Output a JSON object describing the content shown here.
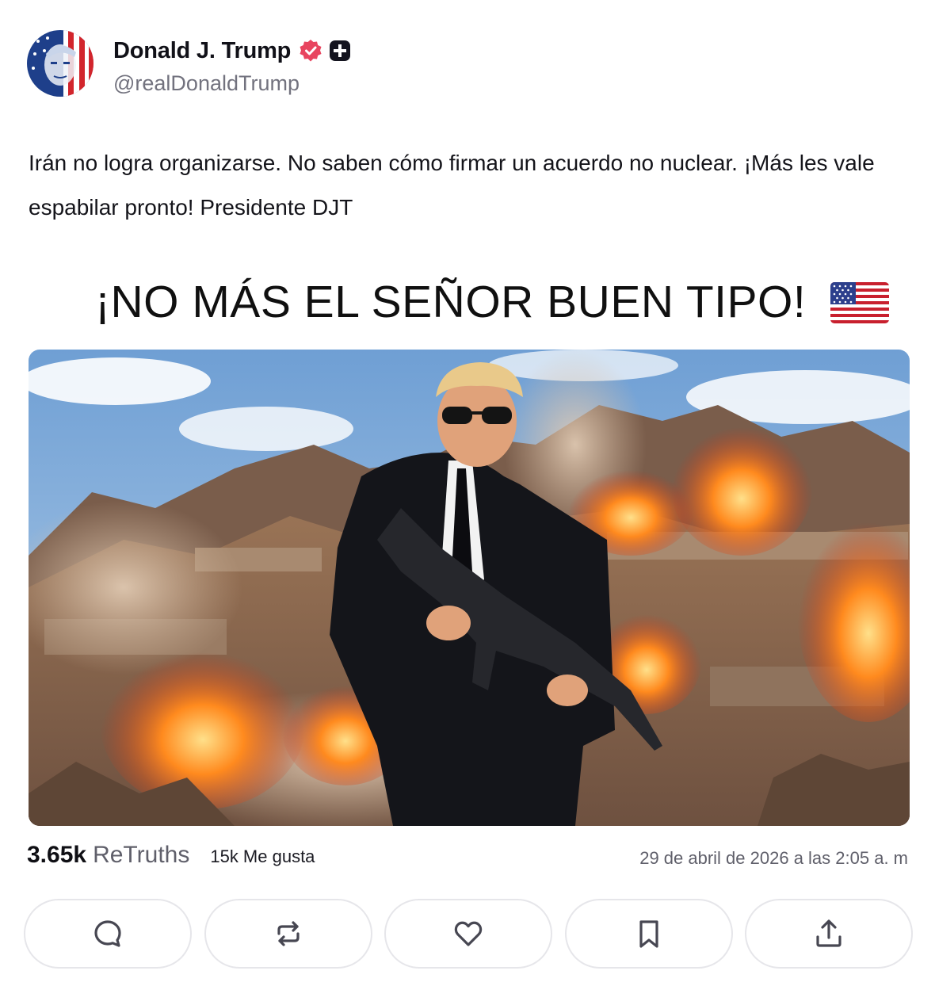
{
  "author": {
    "display_name": "Donald J. Trump",
    "handle": "@realDonaldTrump",
    "verified_icon": "verified-badge-icon",
    "plus_icon": "plus-badge-icon",
    "accent_color": "#e8455f"
  },
  "post": {
    "text": "Irán no logra organizarse. No saben cómo firmar un acuerdo no nuclear. ¡Más les vale espabilar pronto! Presidente DJT",
    "media": {
      "headline": "¡NO MÁS EL SEÑOR BUEN TIPO!",
      "flag_icon": "us-flag-icon"
    }
  },
  "stats": {
    "retruths_count": "3.65k",
    "retruths_label": "ReTruths",
    "likes": "15k Me gusta",
    "timestamp": "29 de abril de 2026 a las 2:05 a. m"
  },
  "actions": [
    {
      "icon": "reply-icon"
    },
    {
      "icon": "retruth-icon"
    },
    {
      "icon": "like-icon"
    },
    {
      "icon": "bookmark-icon"
    },
    {
      "icon": "share-icon"
    }
  ],
  "colors": {
    "text": "#0f0f14",
    "muted": "#72727e",
    "border": "#e6e6ea",
    "icon": "#474752"
  }
}
